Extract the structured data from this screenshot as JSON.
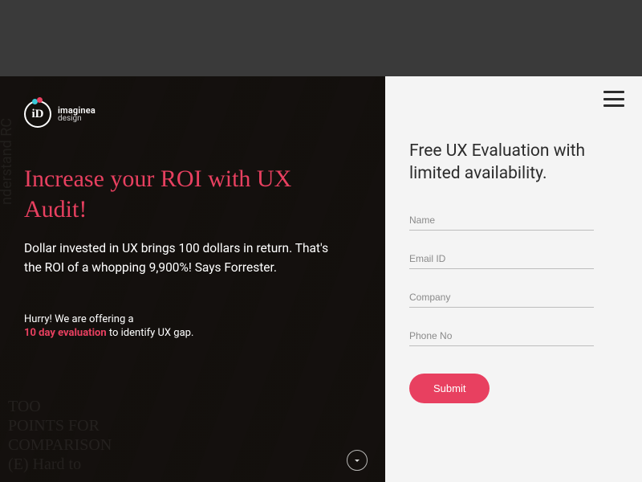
{
  "brand": {
    "name": "imaginea",
    "sub": "design",
    "mark": "iD"
  },
  "left": {
    "headline": "Increase your ROI with UX Audit!",
    "subhead": "Dollar invested in UX brings 100 dollars in return. That's the ROI of a whopping 9,900%! Says Forrester.",
    "offer_intro": "Hurry! We are offering a",
    "offer_highlight": "10 day evaluation",
    "offer_rest": " to identify UX gap."
  },
  "right": {
    "title": "Free UX Evaluation with limited availability.",
    "fields": {
      "name": "Name",
      "email": "Email ID",
      "company": "Company",
      "phone": "Phone No"
    },
    "submit": "Submit"
  }
}
